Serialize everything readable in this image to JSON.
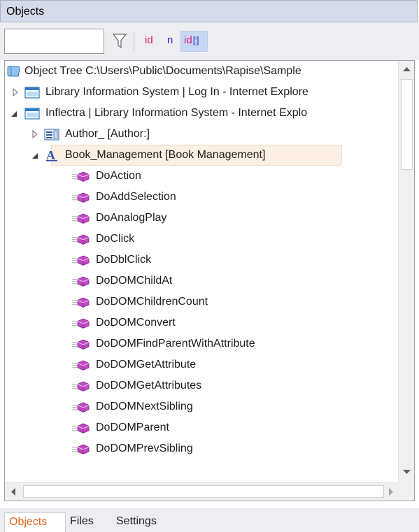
{
  "panel": {
    "title": "Objects"
  },
  "filter": {
    "value": "",
    "id_label": "id",
    "n_label": "n",
    "idsel_label": "id"
  },
  "tree": {
    "root": "Object Tree C:\\Users\\Public\\Documents\\Rapise\\Sample",
    "window1": "Library Information System | Log In - Internet Explore",
    "window2": "Inflectra | Library Information System - Internet Explo",
    "obj1": "Author_ [Author:]",
    "obj2": "Book_Management [Book Management]",
    "actions": [
      "DoAction",
      "DoAddSelection",
      "DoAnalogPlay",
      "DoClick",
      "DoDblClick",
      "DoDOMChildAt",
      "DoDOMChildrenCount",
      "DoDOMConvert",
      "DoDOMFindParentWithAttribute",
      "DoDOMGetAttribute",
      "DoDOMGetAttributes",
      "DoDOMNextSibling",
      "DoDOMParent",
      "DoDOMPrevSibling"
    ]
  },
  "tabs": [
    {
      "label": "Objects",
      "active": true
    },
    {
      "label": "Files",
      "active": false
    },
    {
      "label": "Settings",
      "active": false
    }
  ],
  "colors": {
    "selection": "#fcefe3",
    "accent_tab": "#e0651c",
    "method_icon": "#b03ab5"
  }
}
